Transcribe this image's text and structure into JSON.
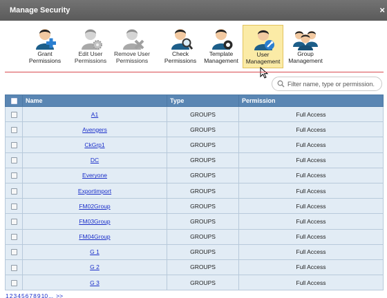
{
  "window": {
    "title": "Manage Security",
    "close_label": "×"
  },
  "toolbar": {
    "items": [
      {
        "label": "Grant\nPermissions",
        "icon": "user-add-icon",
        "state": "enabled"
      },
      {
        "label": "Edit User\nPermissions",
        "icon": "user-edit-icon",
        "state": "disabled"
      },
      {
        "label": "Remove User\nPermissions",
        "icon": "user-remove-icon",
        "state": "disabled"
      },
      {
        "label": "Check\nPermissions",
        "icon": "user-check-icon",
        "state": "enabled"
      },
      {
        "label": "Template\nManagement",
        "icon": "user-template-icon",
        "state": "enabled"
      },
      {
        "label": "User\nManagement",
        "icon": "user-management-icon",
        "state": "active"
      },
      {
        "label": "Group\nManagement",
        "icon": "group-management-icon",
        "state": "enabled"
      }
    ]
  },
  "filter": {
    "placeholder": "Filter name, type or permission."
  },
  "table": {
    "headers": {
      "name": "Name",
      "type": "Type",
      "permission": "Permission"
    },
    "rows": [
      {
        "name": "A1",
        "type": "GROUPS",
        "permission": "Full Access"
      },
      {
        "name": "Avengers",
        "type": "GROUPS",
        "permission": "Full Access"
      },
      {
        "name": "CkGrp1",
        "type": "GROUPS",
        "permission": "Full Access"
      },
      {
        "name": "DC",
        "type": "GROUPS",
        "permission": "Full Access"
      },
      {
        "name": "Everyone",
        "type": "GROUPS",
        "permission": "Full Access"
      },
      {
        "name": "Exportimport",
        "type": "GROUPS",
        "permission": "Full Access"
      },
      {
        "name": "FM02Group",
        "type": "GROUPS",
        "permission": "Full Access"
      },
      {
        "name": "FM03Group",
        "type": "GROUPS",
        "permission": "Full Access"
      },
      {
        "name": "FM04Group",
        "type": "GROUPS",
        "permission": "Full Access"
      },
      {
        "name": "G 1",
        "type": "GROUPS",
        "permission": "Full Access"
      },
      {
        "name": "G 2",
        "type": "GROUPS",
        "permission": "Full Access"
      },
      {
        "name": "G 3",
        "type": "GROUPS",
        "permission": "Full Access"
      }
    ]
  },
  "pagination": {
    "pages": [
      "1",
      "2",
      "3",
      "4",
      "5",
      "6",
      "7",
      "8",
      "9",
      "10"
    ],
    "ellipsis": "...",
    "next": ">>"
  },
  "colors": {
    "titlebar": "#5a5a5a",
    "header": "#5a86b3",
    "row": "#e2ecf5",
    "active_tool": "#fbeba6",
    "accent_line": "#d9494f",
    "link": "#1a2ec9"
  }
}
